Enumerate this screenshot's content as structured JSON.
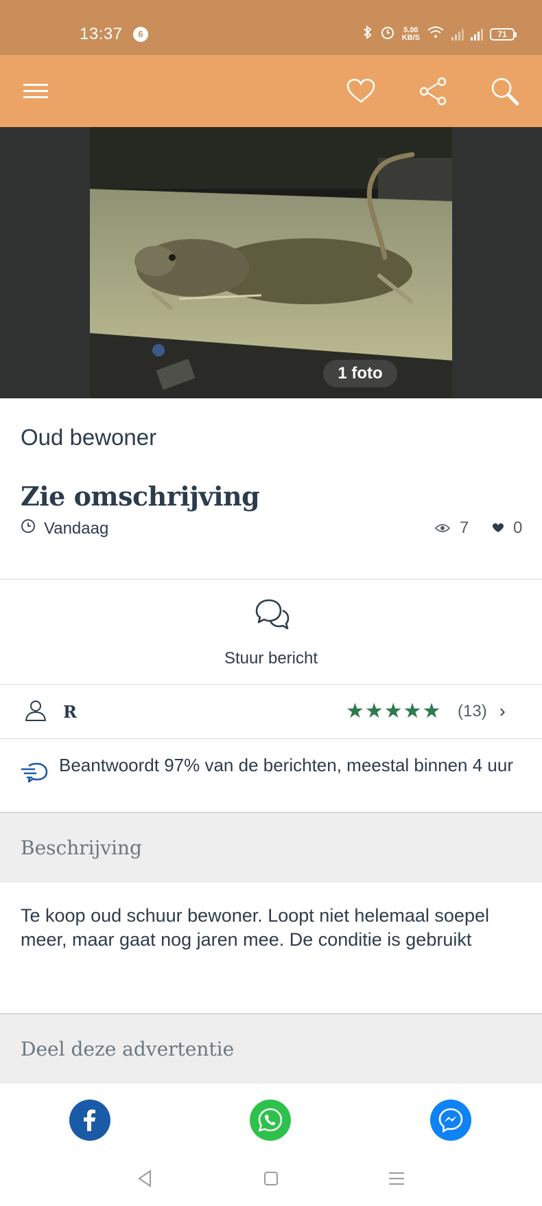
{
  "status_bar": {
    "time": "13:37",
    "notification_count": "6",
    "net_speed_value": "5.00",
    "net_speed_unit": "KB/S",
    "battery": "71"
  },
  "app_bar": {
    "menu_icon": "hamburger-menu-icon",
    "favorite_icon": "heart-icon",
    "share_icon": "share-icon",
    "search_icon": "search-icon"
  },
  "photo": {
    "count_label": "1 foto"
  },
  "ad": {
    "title": "Oud bewoner",
    "price": "Zie omschrijving",
    "date": "Vandaag",
    "views": "7",
    "favorites": "0"
  },
  "message": {
    "label": "Stuur bericht"
  },
  "seller": {
    "name": "R",
    "stars": "★★★★★",
    "rating_count": "(13)",
    "chevron": "›"
  },
  "response": {
    "text": "Beantwoordt 97% van de berichten, meestal binnen 4 uur"
  },
  "description": {
    "heading": "Beschrijving",
    "text": "Te koop oud schuur bewoner. Loopt niet helemaal soepel meer, maar gaat nog jaren mee. De conditie is gebruikt"
  },
  "share": {
    "heading": "Deel deze advertentie",
    "buttons": [
      "facebook-icon",
      "whatsapp-icon",
      "messenger-icon"
    ]
  },
  "colors": {
    "status_bar": "#c98e59",
    "app_bar": "#eba465",
    "text": "#2d3c4d",
    "stars": "#2d7a4f",
    "facebook": "#1b5aa6",
    "whatsapp": "#2cc24b",
    "messenger": "#0f82f5"
  }
}
